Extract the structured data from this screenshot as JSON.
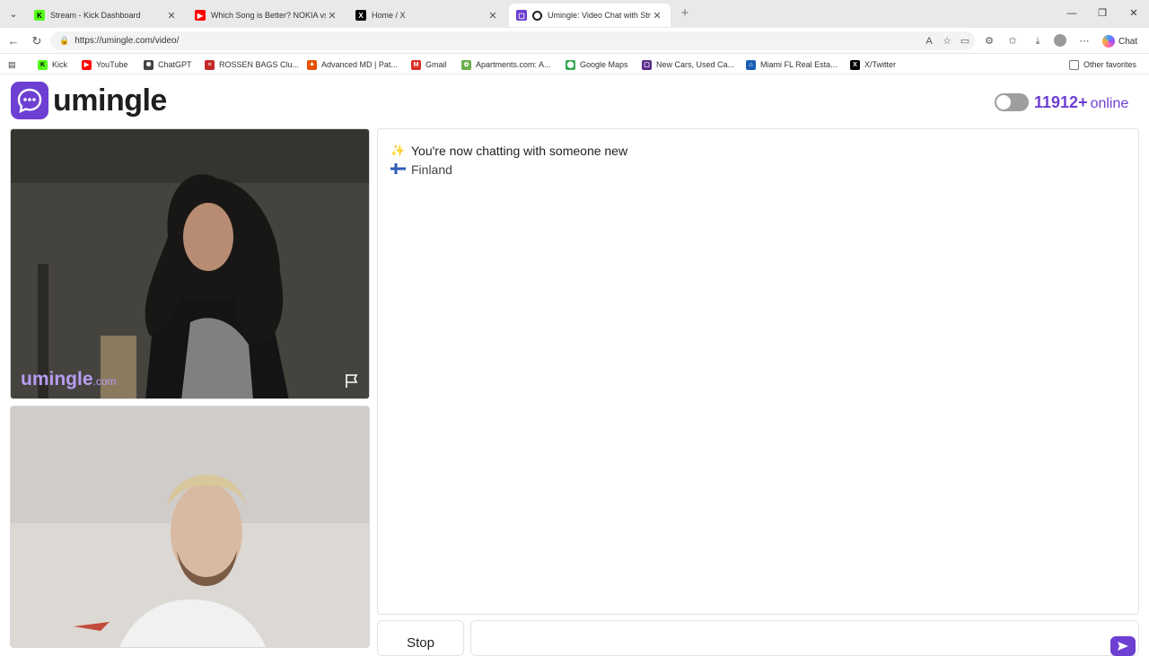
{
  "browser": {
    "tabs": [
      {
        "title": "Stream - Kick Dashboard",
        "favicon": "kick-icon",
        "color": "#53fc18",
        "active": false
      },
      {
        "title": "Which Song is Better? NOKIA vs. I",
        "favicon": "youtube-icon",
        "color": "#ff0000",
        "active": false
      },
      {
        "title": "Home / X",
        "favicon": "x-icon",
        "color": "#000000",
        "active": false
      },
      {
        "title": "Umingle: Video Chat with Str",
        "favicon": "umingle-icon",
        "color": "#6d3fd2",
        "active": true
      }
    ],
    "url": "https://umingle.com/video/",
    "chat_label": "Chat",
    "bookmarks": [
      {
        "label": "Kick",
        "icon": "kick-icon",
        "color": "#53fc18"
      },
      {
        "label": "YouTube",
        "icon": "youtube-icon",
        "color": "#ff0000"
      },
      {
        "label": "ChatGPT",
        "icon": "chatgpt-icon",
        "color": "#444444"
      },
      {
        "label": "ROSSEN BAGS Clu...",
        "icon": "rossen-icon",
        "color": "#c62828"
      },
      {
        "label": "Advanced MD | Pat...",
        "icon": "advancedmd-icon",
        "color": "#e65100"
      },
      {
        "label": "Gmail",
        "icon": "gmail-icon",
        "color": "#d93025"
      },
      {
        "label": "Apartments.com: A...",
        "icon": "apartments-icon",
        "color": "#6ab04c"
      },
      {
        "label": "Google Maps",
        "icon": "maps-icon",
        "color": "#34a853"
      },
      {
        "label": "New Cars, Used Ca...",
        "icon": "cars-icon",
        "color": "#5b2d8c"
      },
      {
        "label": "Miami FL Real Esta...",
        "icon": "realestate-icon",
        "color": "#1a5fb4"
      },
      {
        "label": "X/Twitter",
        "icon": "x-icon",
        "color": "#000000"
      }
    ],
    "other_favorites": "Other favorites"
  },
  "site": {
    "logo_text": "umingle",
    "online_count": "11912",
    "online_plus": "+",
    "online_label": "online",
    "accent": "#6d3fd2"
  },
  "video": {
    "watermark_main": "umingle",
    "watermark_domain": ".com"
  },
  "chat": {
    "messages": [
      {
        "icon": "sparkles-icon",
        "glyph": "✨",
        "text": "You're now chatting with someone new"
      },
      {
        "icon": "finland-flag-icon",
        "glyph": "",
        "text": "Finland"
      }
    ],
    "stop_label": "Stop",
    "input_placeholder": ""
  }
}
